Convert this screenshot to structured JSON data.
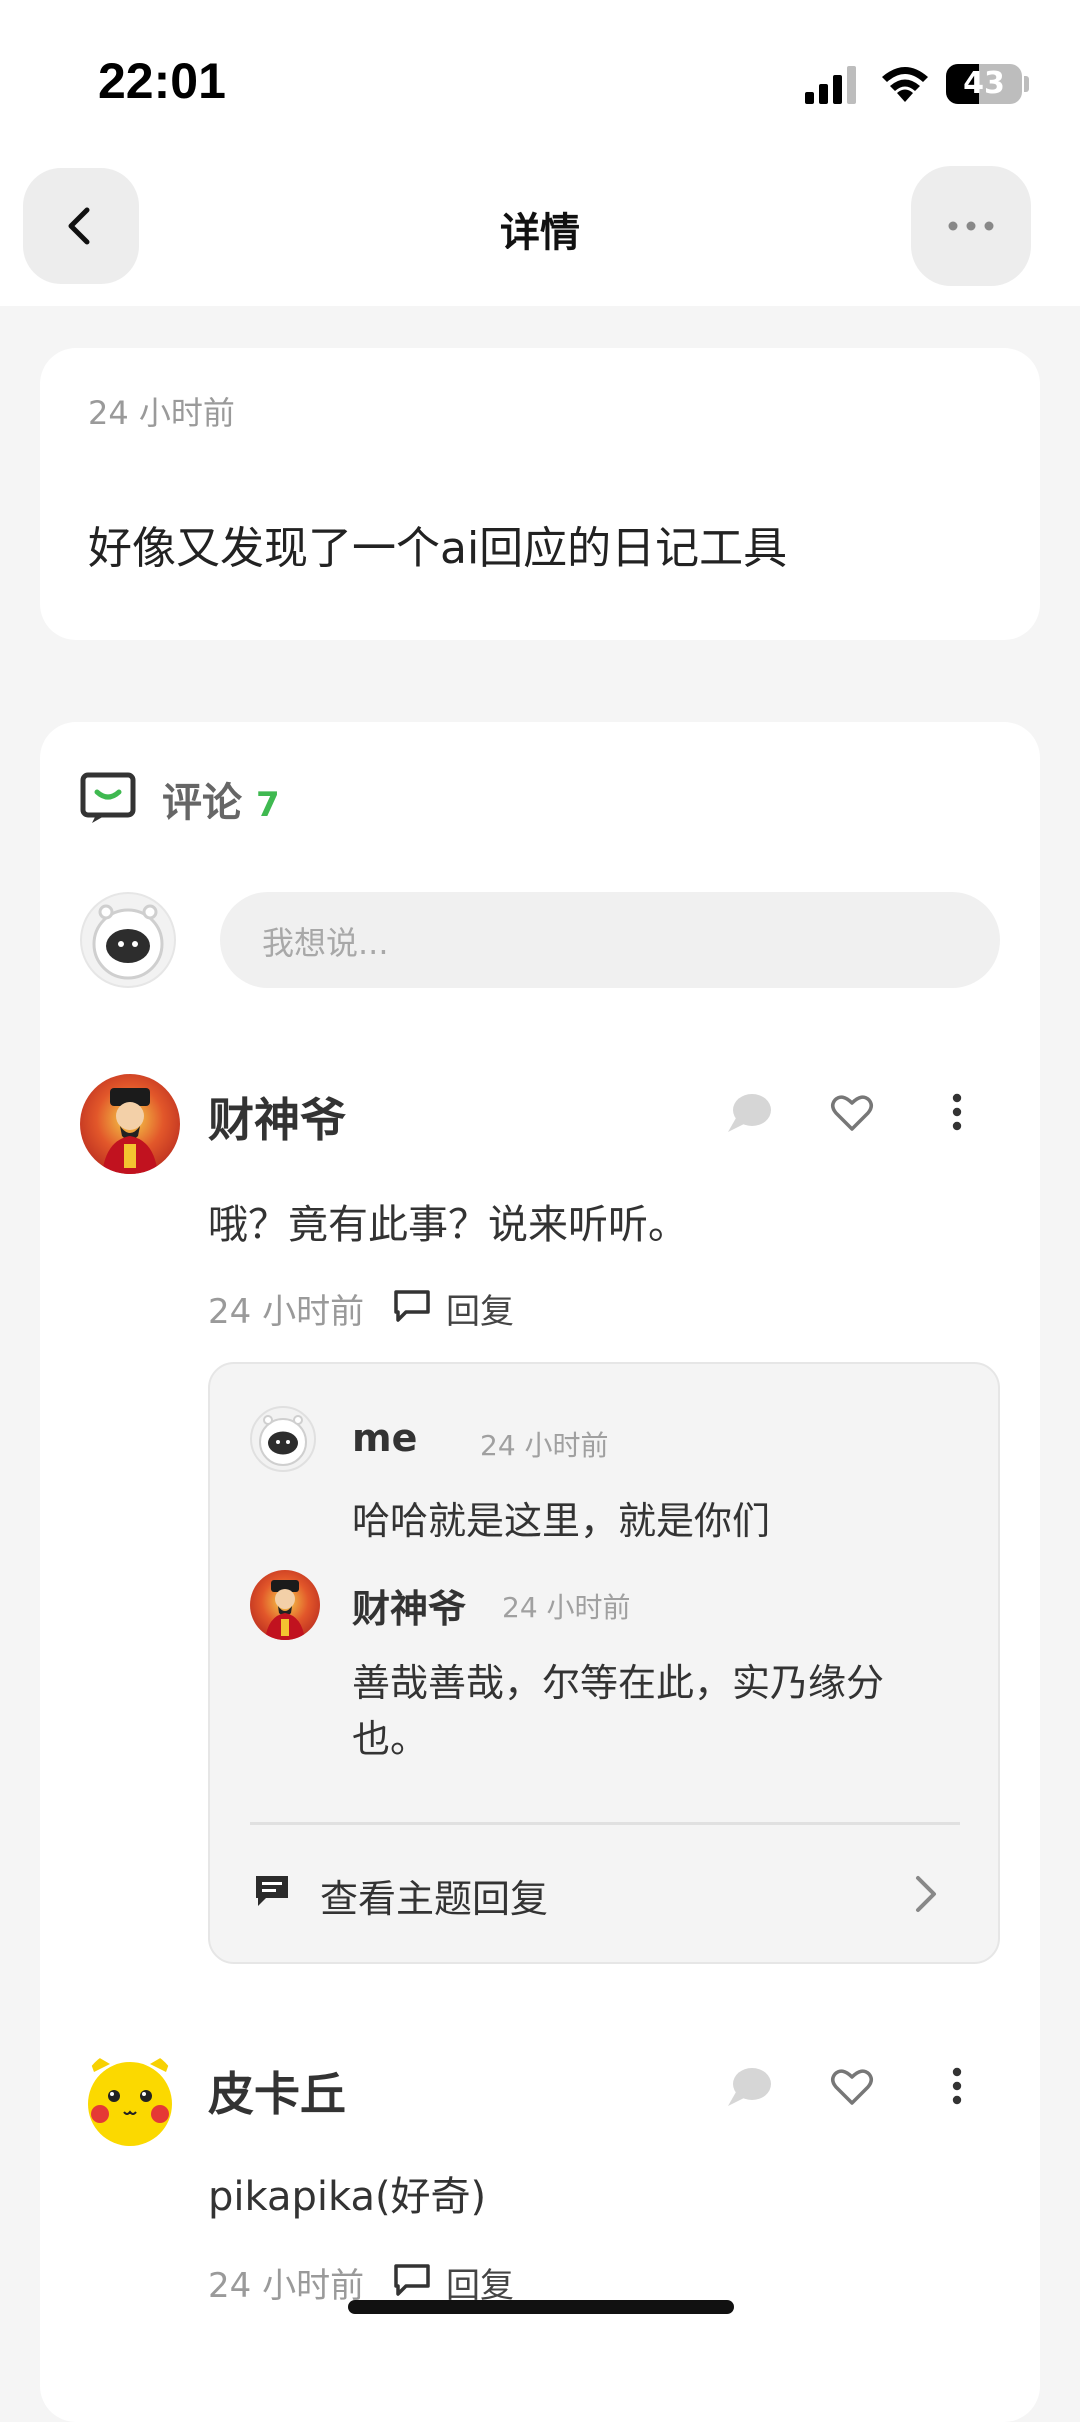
{
  "status": {
    "time": "22:01",
    "battery": "43"
  },
  "header": {
    "title": "详情"
  },
  "post": {
    "time": "24 小时前",
    "content": "好像又发现了一个ai回应的日记工具"
  },
  "comments_section": {
    "label": "评论",
    "count": "7",
    "input_placeholder": "我想说..."
  },
  "comments": [
    {
      "name": "财神爷",
      "text": "哦？竟有此事？说来听听。",
      "time": "24 小时前",
      "reply_label": "回复",
      "replies": [
        {
          "name": "me",
          "time": "24 小时前",
          "text": "哈哈就是这里，就是你们"
        },
        {
          "name": "财神爷",
          "time": "24 小时前",
          "text_line1": "善哉善哉，尔等在此，实乃缘分",
          "text_line2": "也。"
        }
      ],
      "view_thread_label": "查看主题回复"
    },
    {
      "name": "皮卡丘",
      "text": "pikapika(好奇)",
      "time": "24 小时前",
      "reply_label": "回复"
    }
  ],
  "colors": {
    "accent_green": "#3fb950",
    "background": "#f5f5f5",
    "card": "#ffffff"
  }
}
